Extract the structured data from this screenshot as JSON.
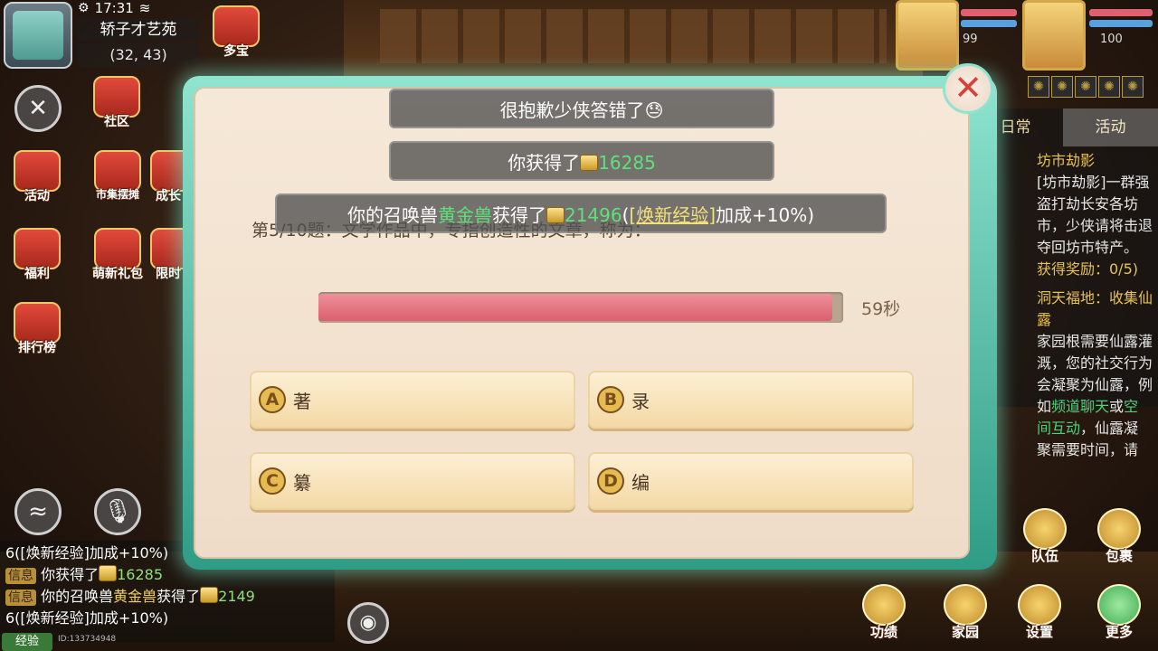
{
  "status_bar": {
    "time": "17:31"
  },
  "player": {
    "location": "轿子才艺苑",
    "coords": "(32, 43)"
  },
  "left_menu": [
    {
      "id": "duobao",
      "label": "多宝"
    },
    {
      "id": "shequ",
      "label": "社区"
    },
    {
      "id": "huodong",
      "label": "活动"
    },
    {
      "id": "shangcheng",
      "label": "市集摆摊"
    },
    {
      "id": "chengzhang",
      "label": "成长"
    },
    {
      "id": "fuli",
      "label": "福利"
    },
    {
      "id": "mengxin",
      "label": "萌新礼包"
    },
    {
      "id": "xianshi",
      "label": "限时"
    },
    {
      "id": "paihang",
      "label": "排行榜"
    }
  ],
  "party": {
    "member1_level": "99",
    "member2_level": "100"
  },
  "quest_panel": {
    "tab_daily": "日常",
    "tab_activity": "活动",
    "entry1_title": "坊市劫影",
    "entry1_text": "[坊市劫影]一群强盗打劫长安各坊市，少侠请将击退夺回坊市特产。",
    "entry1_reward": "获得奖励：0/5)",
    "entry2_title": "洞天福地：收集仙露",
    "entry2_text_a": "家园根需要仙露灌溉，您的社交行为会凝聚为仙露，例如",
    "entry2_text_hl1": "频道聊天",
    "entry2_text_or": "或",
    "entry2_text_hl2": "空间互动",
    "entry2_text_b": "，仙露凝聚需要时间，请"
  },
  "quiz": {
    "question": "第5/10题：文学作品中，专指创造性的文章，称为：",
    "timer_text": "59秒",
    "timer_fraction": 0.98,
    "options": [
      {
        "letter": "A",
        "text": "著"
      },
      {
        "letter": "B",
        "text": "录"
      },
      {
        "letter": "C",
        "text": "纂"
      },
      {
        "letter": "D",
        "text": "编"
      }
    ]
  },
  "toasts": {
    "wrong": "很抱歉少侠答错了",
    "gain_prefix": "你获得了",
    "gain_amount": "16285",
    "pet_prefix": "你的召唤兽",
    "pet_name": "黄金兽",
    "pet_mid": "获得了",
    "pet_amount": "21496",
    "pet_open": "(",
    "pet_link": "[焕新经验]",
    "pet_suffix": "加成+10%)"
  },
  "chat": {
    "line0": "6([焕新经验]加成+10%)",
    "tag": "信息",
    "line1_text": "你获得了",
    "line1_amount": "16285",
    "line2_text": "你的召唤兽",
    "line2_pet": "黄金兽",
    "line2_mid": "获得了",
    "line2_amount": "2149",
    "line3": "6([焕新经验]加成+10%)",
    "exp_label": "经验",
    "player_id": "ID:133734948"
  },
  "bottom_right": [
    {
      "id": "duiwu",
      "label": "队伍"
    },
    {
      "id": "baoguo",
      "label": "包裹"
    },
    {
      "id": "gongji",
      "label": "功绩"
    },
    {
      "id": "jiayuan",
      "label": "家园"
    },
    {
      "id": "shezhi",
      "label": "设置"
    },
    {
      "id": "gengduo",
      "label": "更多"
    }
  ],
  "colors": {
    "accent_green": "#5fe07a",
    "timer_pink": "#d9606f",
    "frame_teal": "#8fe4cf",
    "close_red": "#d9413b"
  }
}
